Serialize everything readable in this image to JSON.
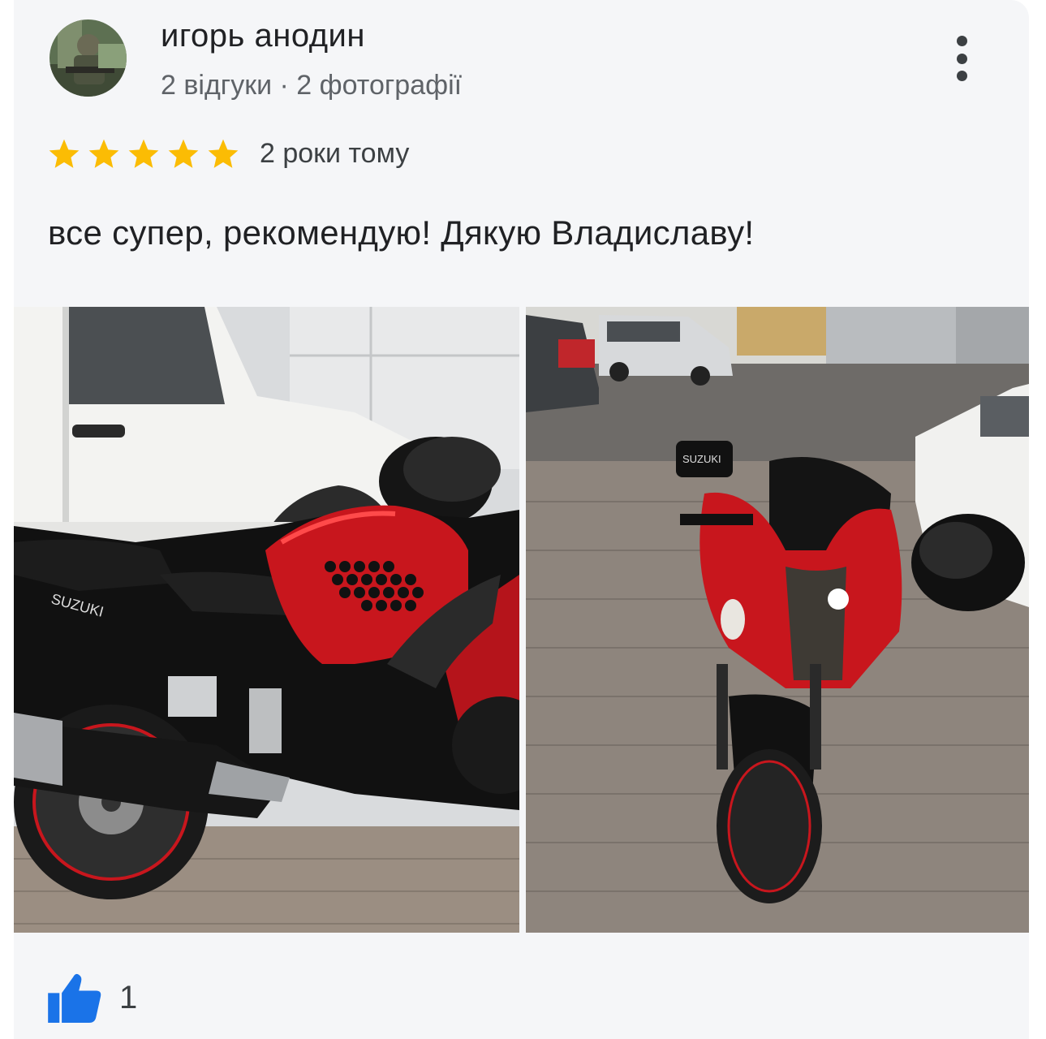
{
  "review": {
    "reviewer_name": "игорь анодин",
    "reviewer_meta": "2 відгуки · 2 фотографії",
    "rating": 5,
    "date": "2 роки тому",
    "text": "все супер, рекомендую! Дякую Владиславу!",
    "likes": "1"
  },
  "icons": {
    "more": "more-vert-icon",
    "star": "star-icon",
    "like": "thumb-up-icon"
  },
  "colors": {
    "star": "#fbbc04",
    "like": "#1a73e8",
    "card_bg": "#f5f6f8"
  },
  "photo_labels": {
    "side_brand": "SUZUKI",
    "mirror_brand": "SUZUKI"
  }
}
